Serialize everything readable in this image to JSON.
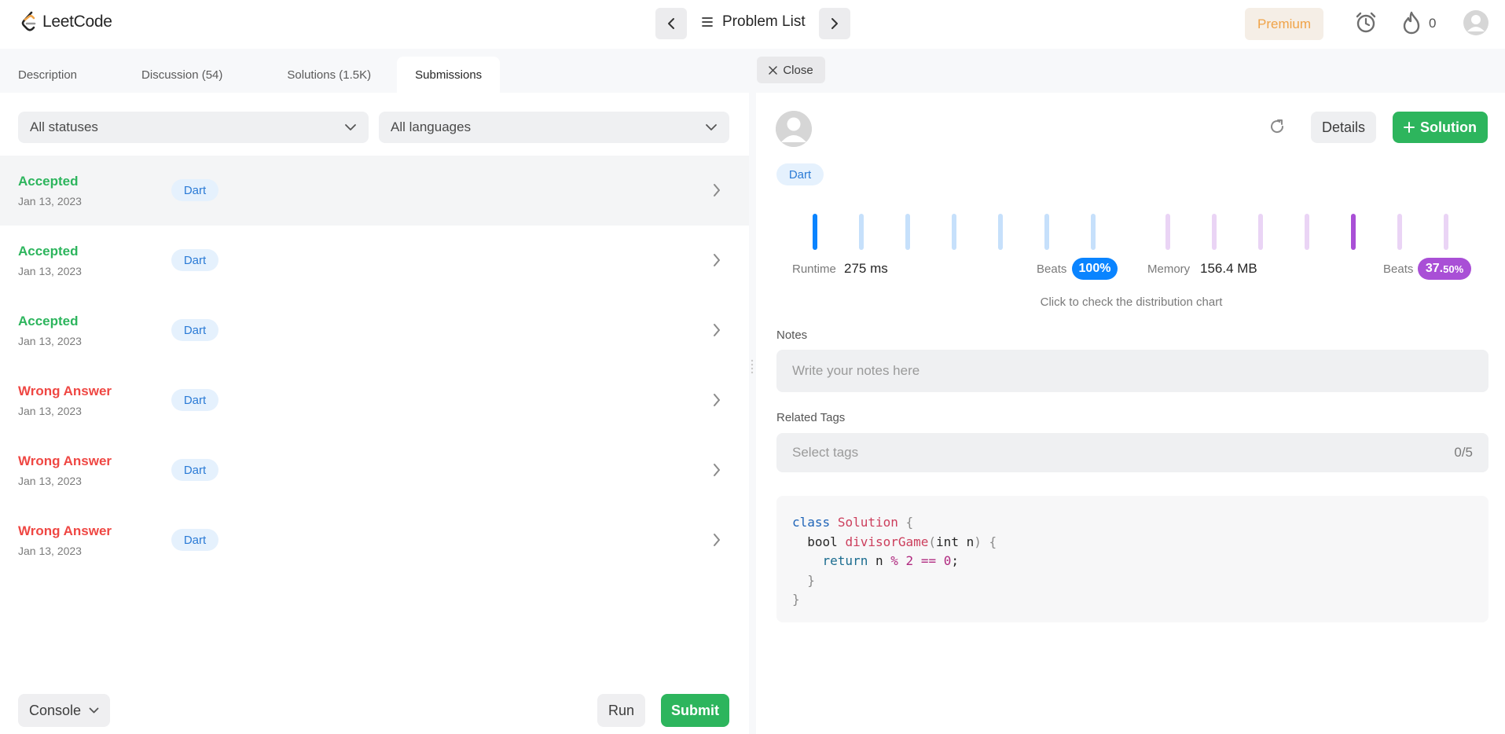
{
  "header": {
    "logo_text": "LeetCode",
    "problem_list_label": "Problem List",
    "premium_label": "Premium",
    "streak_count": "0"
  },
  "tabs": [
    {
      "label": "Description"
    },
    {
      "label": "Discussion (54)"
    },
    {
      "label": "Solutions (1.5K)"
    },
    {
      "label": "Submissions"
    }
  ],
  "close_label": "Close",
  "filters": {
    "status": "All statuses",
    "language": "All languages"
  },
  "submissions": [
    {
      "status": "Accepted",
      "date": "Jan 13, 2023",
      "language": "Dart",
      "status_color": "#2db55d"
    },
    {
      "status": "Accepted",
      "date": "Jan 13, 2023",
      "language": "Dart",
      "status_color": "#2db55d"
    },
    {
      "status": "Accepted",
      "date": "Jan 13, 2023",
      "language": "Dart",
      "status_color": "#2db55d"
    },
    {
      "status": "Wrong Answer",
      "date": "Jan 13, 2023",
      "language": "Dart",
      "status_color": "#ef4743"
    },
    {
      "status": "Wrong Answer",
      "date": "Jan 13, 2023",
      "language": "Dart",
      "status_color": "#ef4743"
    },
    {
      "status": "Wrong Answer",
      "date": "Jan 13, 2023",
      "language": "Dart",
      "status_color": "#ef4743"
    }
  ],
  "bottom": {
    "console_label": "Console",
    "run_label": "Run",
    "submit_label": "Submit"
  },
  "detail": {
    "details_label": "Details",
    "solution_label": "Solution",
    "language": "Dart",
    "runtime_label": "Runtime",
    "runtime_value": "275 ms",
    "runtime_beats_label": "Beats",
    "runtime_beats": "100%",
    "memory_label": "Memory",
    "memory_value": "156.4 MB",
    "memory_beats_label": "Beats",
    "memory_beats_main": "37.",
    "memory_beats_small": "50%",
    "distribution_hint": "Click to check the distribution chart",
    "notes_label": "Notes",
    "notes_placeholder": "Write your notes here",
    "tags_label": "Related Tags",
    "tags_placeholder": "Select tags",
    "tags_count": "0/5",
    "runtime_bars_active_index": 0,
    "memory_bars_active_index": 4,
    "colors": {
      "runtime_active": "#0a84ff",
      "runtime_inactive": "#c6e0fb",
      "memory_active": "#a94fd6",
      "memory_inactive": "#ead4f5"
    }
  },
  "code": {
    "line1": {
      "kw": "class",
      "name": "Solution",
      "brace": "{"
    },
    "line2": {
      "type": "bool",
      "fn": "divisorGame",
      "open": "(",
      "ptype": "int",
      "param": "n",
      "close": ")",
      "brace": "{"
    },
    "line3": {
      "kw": "return",
      "var": "n",
      "op1": "%",
      "n1": "2",
      "op2": "==",
      "n2": "0",
      "semi": ";"
    },
    "line4": "}",
    "line5": "}"
  }
}
